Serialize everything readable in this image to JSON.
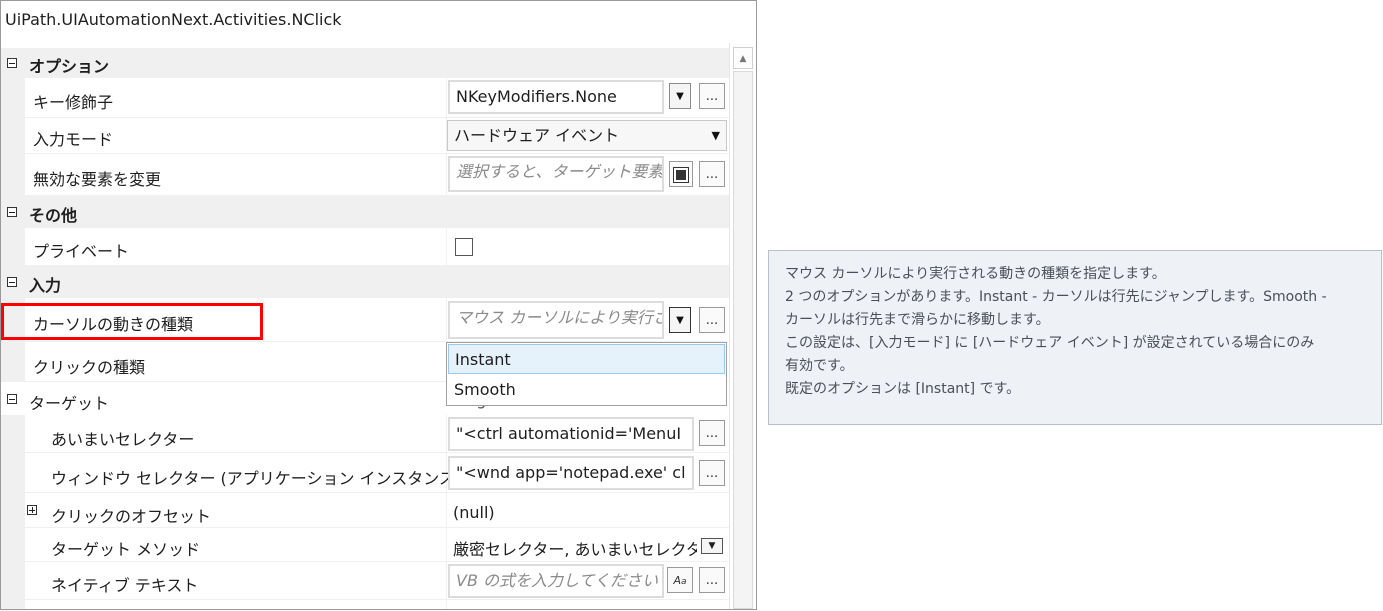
{
  "panel": {
    "title": "UiPath.UIAutomationNext.Activities.NClick"
  },
  "categories": {
    "options": "オプション",
    "other": "その他",
    "input": "入力",
    "target": "ターゲット"
  },
  "props": {
    "key_modifier": {
      "name": "キー修飾子",
      "value": "NKeyModifiers.None",
      "ellipsis": "..."
    },
    "input_mode": {
      "name": "入力モード",
      "value": "ハードウェア イベント"
    },
    "alter_disabled": {
      "name": "無効な要素を変更",
      "placeholder": "選択すると、ターゲット要素,",
      "ellipsis": "..."
    },
    "private": {
      "name": "プライベート",
      "checked": false
    },
    "cursor_motion": {
      "name": "カーソルの動きの種類",
      "placeholder": "マウス カーソルにより実行さ",
      "ellipsis": "..."
    },
    "click_type": {
      "name": "クリックの種類"
    },
    "target_value_partial": "TargetAnchorable",
    "fuzzy_selector": {
      "name": "あいまいセレクター",
      "value": "\"<ctrl automationid='MenuI",
      "ellipsis": "..."
    },
    "window_selector": {
      "name": "ウィンドウ セレクター (アプリケーション インスタンス)",
      "value": "\"<wnd app='notepad.exe' cl",
      "ellipsis": "..."
    },
    "click_offset": {
      "name": "クリックのオフセット",
      "value": "(null)"
    },
    "target_method": {
      "name": "ターゲット メソッド",
      "value": "厳密セレクター, あいまいセレクター"
    },
    "native_text": {
      "name": "ネイティブ テキスト",
      "placeholder": "VB の式を入力してください",
      "ellipsis": "..."
    }
  },
  "dropdown": {
    "items": [
      "Instant",
      "Smooth"
    ],
    "highlighted": "Instant"
  },
  "tooltip": {
    "lines": [
      "マウス カーソルにより実行される動きの種類を指定します。",
      "2 つのオプションがあります。Instant - カーソルは行先にジャンプします。Smooth -",
      "カーソルは行先まで滑らかに移動します。",
      "この設定は、[入力モード] に [ハードウェア イベント] が設定されている場合にのみ",
      "有効です。",
      "既定のオプションは [Instant] です。"
    ]
  },
  "colors": {
    "highlight": "#ff0000",
    "tooltip_bg": "#eef1f5",
    "category_bg": "#f0f0f0",
    "selected_item_bg": "#e5f1fb"
  }
}
